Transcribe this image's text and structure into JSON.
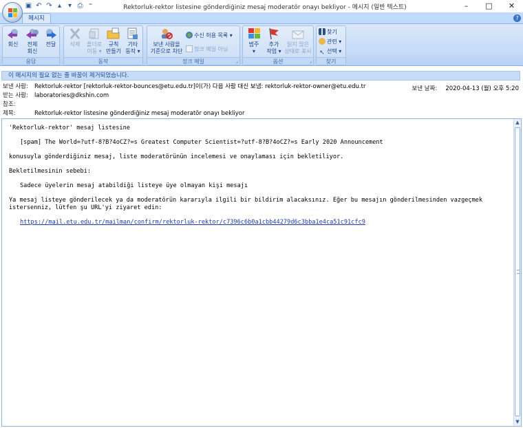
{
  "window": {
    "title": "Rektorluk-rektor listesine gönderdiğiniz mesaj moderatör onayı bekliyor - 메시지 (일반 텍스트)",
    "controls": [
      "–",
      "□",
      "✕"
    ]
  },
  "quick_access": [
    "save-icon",
    "undo-icon",
    "redo-icon",
    "up-icon",
    "down-icon",
    "print-preview-icon",
    "customize-icon"
  ],
  "ribbon": {
    "active_tab": "메시지",
    "groups": {
      "respond": {
        "label": "응답",
        "reply": "회신",
        "reply_all_1": "전체",
        "reply_all_2": "회신",
        "forward": "전달"
      },
      "actions": {
        "label": "동작",
        "delete": "삭제",
        "move_1": "폴더로",
        "move_2": "이동 ▾",
        "rules_1": "규칙",
        "rules_2": "만들기",
        "other_1": "기타",
        "other_2": "동작 ▾"
      },
      "junk": {
        "label": "정크 메일",
        "block_1": "보낸 사람을",
        "block_2": "기준으로 차단",
        "safe_lists": "수신 허용 목록 ▾",
        "not_junk": "정크 메일 아님"
      },
      "options": {
        "label": "옵션",
        "categorize_1": "범주",
        "categorize_2": "▾",
        "followup_1": "추가",
        "followup_2": "작업 ▾",
        "mark_unread_1": "읽지 않은",
        "mark_unread_2": "상태로 표시"
      },
      "find": {
        "label": "찾기",
        "find": "찾기",
        "related": "관련 ▾",
        "select": "선택 ▾"
      }
    }
  },
  "infobar": "이 메시지의 필요 없는 줄 바꿈이 제거되었습니다.",
  "header": {
    "from_label": "보낸 사람:",
    "from_value": "Rektorluk-rektor [rektorluk-rektor-bounces@etu.edu.tr]이(가) 다음 사람 대신 보냄: rektorluk-rektor-owner@etu.edu.tr",
    "to_label": "받는 사람:",
    "to_value": "laboratories@dkshin.com",
    "cc_label": "참조:",
    "cc_value": "",
    "subject_label": "제목:",
    "subject_value": "Rektorluk-rektor listesine gönderdiğiniz mesaj moderatör onayı bekliyor",
    "sent_label": "보낸 날짜:",
    "sent_value": "2020-04-13 (월) 오후 5:20"
  },
  "body": {
    "p1": "'Rektorluk-rektor' mesaj listesine",
    "p2": "[spam] The World=?utf-8?B?4oCZ?=s Greatest Computer Scientist=?utf-8?B?4oCZ?=s Early 2020 Announcement",
    "p3": "konusuyla gönderdiğiniz mesaj, liste moderatörünün incelemesi ve onaylaması için bekletiliyor.",
    "p4": "Bekletilmesinin sebebi:",
    "p5": "Sadece üyelerin mesaj atabildiği listeye üye olmayan kişi mesajı",
    "p6": "Ya mesaj listeye gönderilecek ya da moderatörün kararıyla ilgili bir bildirim alacaksınız. Eğer bu mesajın gönderilmesinden vazgeçmek istersenniz, lütfen şu URL'yi ziyaret edin:",
    "link": "https://mail.etu.edu.tr/mailman/confirm/rektorluk-rektor/c7396c6b0a1cbb44279d6c3bba1e4ca51c91cfc9"
  }
}
